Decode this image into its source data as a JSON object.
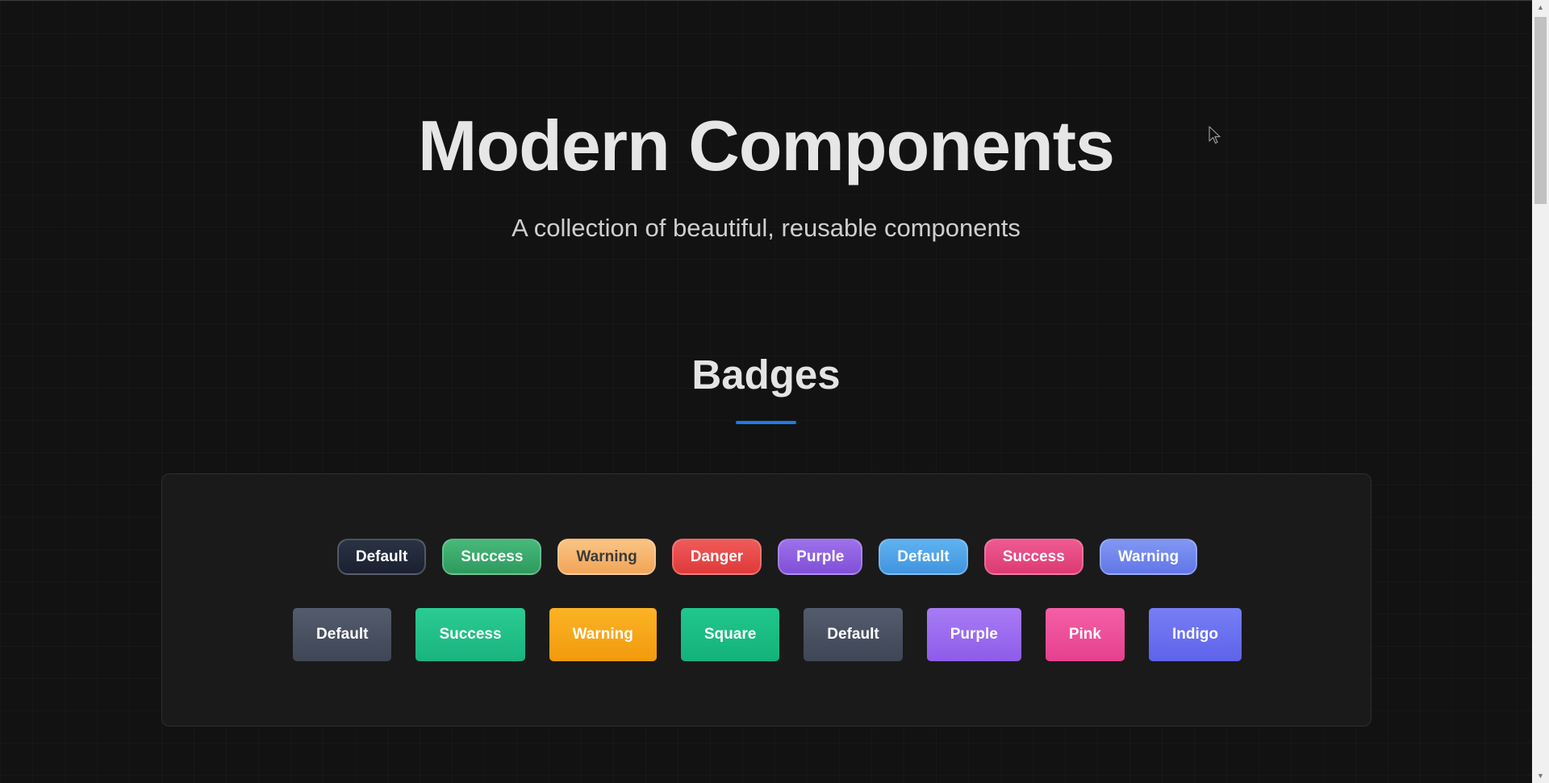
{
  "hero": {
    "title": "Modern Components",
    "subtitle": "A collection of beautiful, reusable components"
  },
  "section": {
    "title": "Badges",
    "underline_color": "#1f7ae8"
  },
  "pill_badges": [
    {
      "label": "Default",
      "color": "#1e2535",
      "gradient": "linear-gradient(180deg,#2a3244,#1a2030)",
      "text": "#ffffff"
    },
    {
      "label": "Success",
      "color": "#3aa86c",
      "gradient": "linear-gradient(180deg,#46b979,#2f9a5e)",
      "text": "#ffffff"
    },
    {
      "label": "Warning",
      "color": "#f5b26b",
      "gradient": "linear-gradient(180deg,#fac482,#f1a55a)",
      "text": "#3a3a3a"
    },
    {
      "label": "Danger",
      "color": "#e84848",
      "gradient": "linear-gradient(180deg,#f05a5a,#df3a3a)",
      "text": "#ffffff"
    },
    {
      "label": "Purple",
      "color": "#8e5fe0",
      "gradient": "linear-gradient(180deg,#9d70ec,#8050d6)",
      "text": "#ffffff"
    },
    {
      "label": "Default",
      "color": "#4ea3e6",
      "gradient": "linear-gradient(180deg,#5fb2f0,#4194de)",
      "text": "#ffffff"
    },
    {
      "label": "Success",
      "color": "#e4477f",
      "gradient": "linear-gradient(180deg,#ee5a90,#dc3a72)",
      "text": "#ffffff"
    },
    {
      "label": "Warning",
      "color": "#6f86ec",
      "gradient": "linear-gradient(180deg,#8197f4,#6176e6)",
      "text": "#ffffff"
    }
  ],
  "block_badges": [
    {
      "label": "Default",
      "color": "#4a5262",
      "gradient": "linear-gradient(180deg,#535c6d,#3f4656)",
      "text": "#ffffff"
    },
    {
      "label": "Success",
      "color": "#22c28a",
      "gradient": "linear-gradient(180deg,#2acc93,#1ab37f)",
      "text": "#ffffff"
    },
    {
      "label": "Warning",
      "color": "#f6a416",
      "gradient": "linear-gradient(180deg,#fbb325,#f29a0e)",
      "text": "#ffffff"
    },
    {
      "label": "Square",
      "color": "#18bd84",
      "gradient": "linear-gradient(180deg,#20c78d,#14b27b)",
      "text": "#ffffff"
    },
    {
      "label": "Default",
      "color": "#4a5262",
      "gradient": "linear-gradient(180deg,#535c6d,#3f4656)",
      "text": "#ffffff"
    },
    {
      "label": "Purple",
      "color": "#9c6cf0",
      "gradient": "linear-gradient(180deg,#a87bf5,#8e5ce9)",
      "text": "#ffffff"
    },
    {
      "label": "Pink",
      "color": "#ee4f9b",
      "gradient": "linear-gradient(180deg,#f45fa6,#e6408e)",
      "text": "#ffffff"
    },
    {
      "label": "Indigo",
      "color": "#6b71f0",
      "gradient": "linear-gradient(180deg,#777ef5,#5e63ea)",
      "text": "#ffffff"
    }
  ]
}
